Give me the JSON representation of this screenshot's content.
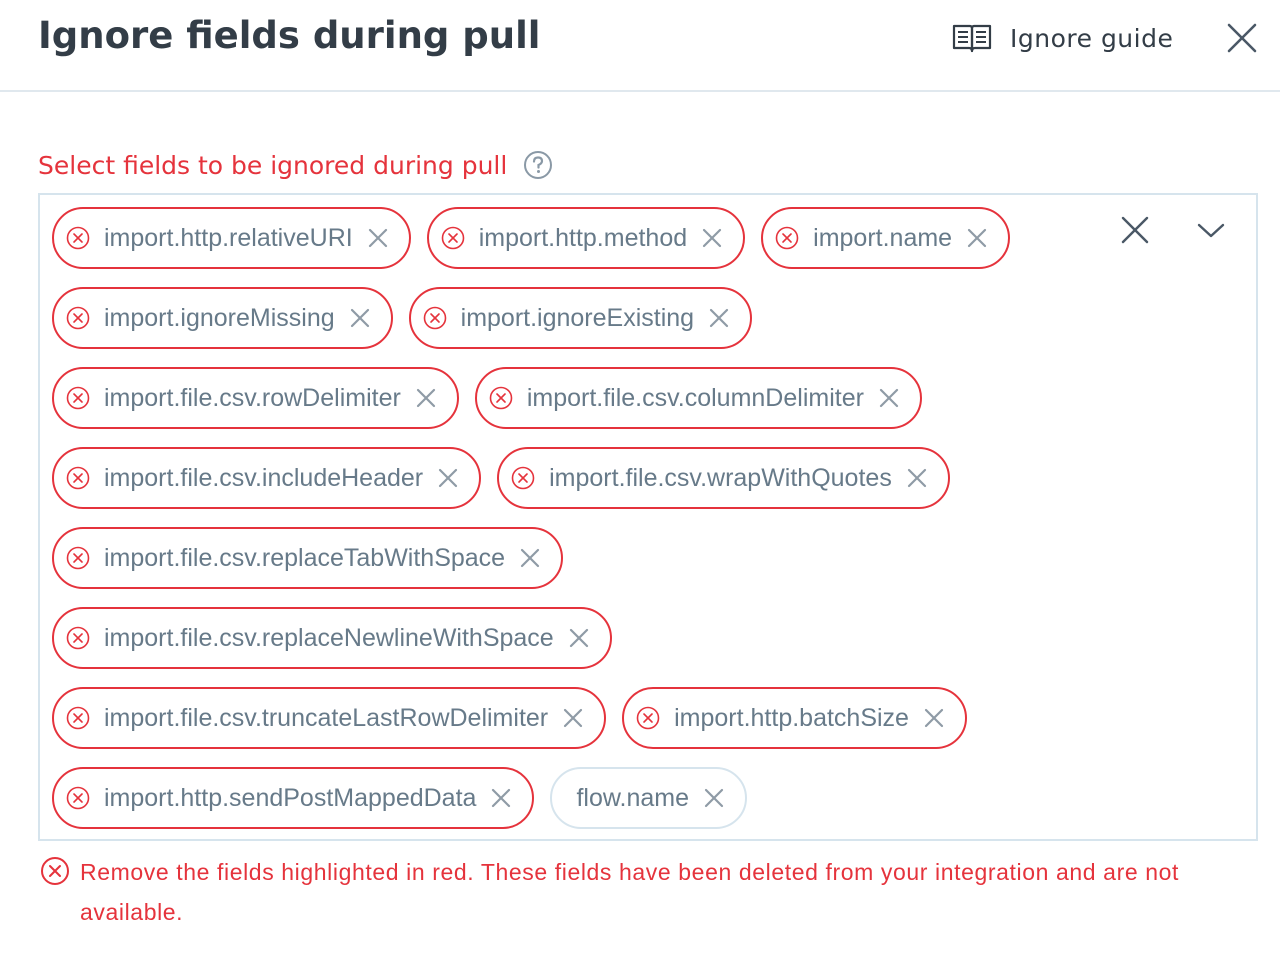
{
  "header": {
    "title": "Ignore fields during pull",
    "guide_label": "Ignore guide"
  },
  "field": {
    "label": "Select fields to be ignored during pull"
  },
  "chips": [
    {
      "label": "import.http.relativeURI",
      "status": "error"
    },
    {
      "label": "import.http.method",
      "status": "error"
    },
    {
      "label": "import.name",
      "status": "error"
    },
    {
      "label": "import.ignoreMissing",
      "status": "error"
    },
    {
      "label": "import.ignoreExisting",
      "status": "error"
    },
    {
      "label": "import.file.csv.rowDelimiter",
      "status": "error"
    },
    {
      "label": "import.file.csv.columnDelimiter",
      "status": "error"
    },
    {
      "label": "import.file.csv.includeHeader",
      "status": "error"
    },
    {
      "label": "import.file.csv.wrapWithQuotes",
      "status": "error"
    },
    {
      "label": "import.file.csv.replaceTabWithSpace",
      "status": "error"
    },
    {
      "label": "import.file.csv.replaceNewlineWithSpace",
      "status": "error"
    },
    {
      "label": "import.file.csv.truncateLastRowDelimiter",
      "status": "error"
    },
    {
      "label": "import.http.batchSize",
      "status": "error"
    },
    {
      "label": "import.http.sendPostMappedData",
      "status": "error"
    },
    {
      "label": "flow.name",
      "status": "valid"
    }
  ],
  "error": {
    "message": "Remove the fields highlighted in red. These fields have been deleted from your integration and are not available."
  },
  "colors": {
    "error": "#e5333c",
    "border": "#d6e4ed",
    "text": "#333d47",
    "chip_text": "#677a89"
  }
}
